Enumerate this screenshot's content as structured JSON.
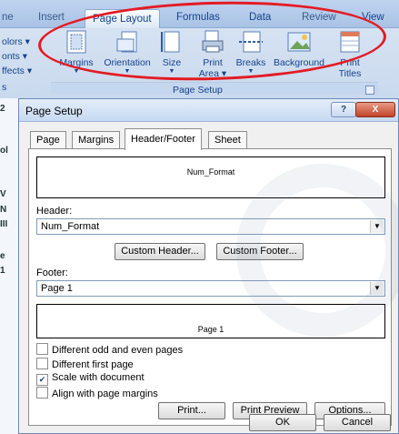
{
  "ribbon": {
    "tabs": [
      {
        "label": "ne",
        "state": "partial"
      },
      {
        "label": "Insert",
        "state": "partial"
      },
      {
        "label": "Page Layout",
        "state": "active"
      },
      {
        "label": "Formulas",
        "state": "normal"
      },
      {
        "label": "Data",
        "state": "normal"
      },
      {
        "label": "Review",
        "state": "partial"
      },
      {
        "label": "View",
        "state": "normal"
      }
    ],
    "left_items": [
      "olors ▾",
      "onts ▾",
      "ffects ▾",
      "s"
    ],
    "buttons": [
      {
        "label": "Margins",
        "icon": "margins-icon"
      },
      {
        "label": "Orientation",
        "icon": "orientation-icon"
      },
      {
        "label": "Size",
        "icon": "size-icon"
      },
      {
        "label": "Print",
        "label2": "Area",
        "icon": "print-area-icon"
      },
      {
        "label": "Breaks",
        "icon": "breaks-icon"
      },
      {
        "label": "Background",
        "icon": "background-icon"
      },
      {
        "label": "Print",
        "label2": "Titles",
        "icon": "print-titles-icon"
      }
    ],
    "group_label": "Page Setup",
    "highlight_color": "#e31b23"
  },
  "sheet_strip": [
    "2",
    "ol",
    "V",
    "N",
    "III",
    "e",
    "1"
  ],
  "dialog": {
    "title": "Page Setup",
    "help_label": "?",
    "close_label": "X",
    "tabs": [
      {
        "label": "Page"
      },
      {
        "label": "Margins"
      },
      {
        "label": "Header/Footer",
        "active": true
      },
      {
        "label": "Sheet"
      }
    ],
    "header_preview": "Num_Format",
    "header_label": "Header:",
    "header_value": "Num_Format",
    "custom_header_label": "Custom Header...",
    "custom_footer_label": "Custom Footer...",
    "footer_label": "Footer:",
    "footer_value": "Page 1",
    "footer_preview": "Page 1",
    "options": [
      {
        "label": "Different odd and even pages",
        "checked": false
      },
      {
        "label": "Different first page",
        "checked": false
      },
      {
        "label": "Scale with document",
        "checked": true
      },
      {
        "label": "Align with page margins",
        "checked": false
      }
    ],
    "print_label": "Print...",
    "print_preview_label": "Print Preview",
    "options_label": "Options...",
    "ok_label": "OK",
    "cancel_label": "Cancel"
  }
}
